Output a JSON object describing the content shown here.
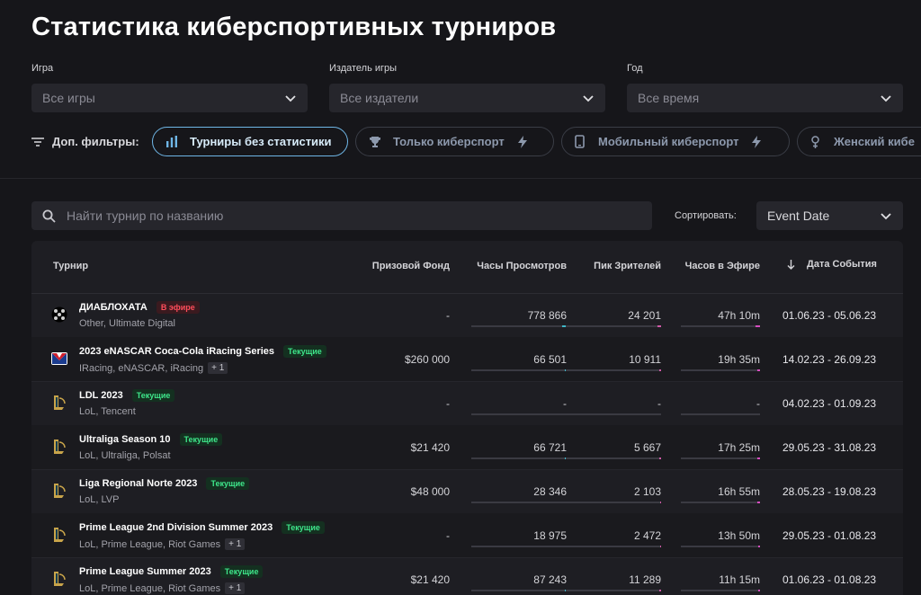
{
  "page_title": "Статистика киберспортивных турниров",
  "filters": {
    "game": {
      "label": "Игра",
      "value": "Все игры"
    },
    "publisher": {
      "label": "Издатель игры",
      "value": "Все издатели"
    },
    "year": {
      "label": "Год",
      "value": "Все время"
    }
  },
  "extra_filters": {
    "label": "Доп. фильтры:",
    "chips": [
      {
        "label": "Турниры без статистики",
        "active": true,
        "icon": "bar-chart-icon"
      },
      {
        "label": "Только киберспорт",
        "active": false,
        "icon": "trophy-icon",
        "badge_icon": "lightning-icon"
      },
      {
        "label": "Мобильный киберспорт",
        "active": false,
        "icon": "phone-icon",
        "badge_icon": "lightning-icon"
      },
      {
        "label": "Женский кибе",
        "active": false,
        "icon": "female-icon"
      }
    ]
  },
  "search": {
    "placeholder": "Найти турнир по названию"
  },
  "sort": {
    "label": "Сортировать:",
    "value": "Event Date"
  },
  "table": {
    "columns": {
      "tournament": "Турнир",
      "prize": "Призовой Фонд",
      "hours_watched": "Часы Просмотров",
      "peak_viewers": "Пик Зрителей",
      "air_hours": "Часов в Эфире",
      "event_date": "Дата События"
    },
    "rows": [
      {
        "name": "ДИАБЛОХАТА",
        "badge": "В эфире",
        "badge_type": "live",
        "sub": "Other, Ultimate Digital",
        "plus": "",
        "prize": "-",
        "hours": "778 866",
        "peak": "24 201",
        "air": "47h 10m",
        "date": "01.06.23 - 05.06.23",
        "logo": "diablo-logo-icon",
        "bars": [
          0.05,
          0.04,
          0.06
        ]
      },
      {
        "name": "2023 eNASCAR Coca-Cola iRacing Series",
        "badge": "Текущие",
        "badge_type": "cur",
        "sub": "IRacing, eNASCAR, iRacing",
        "plus": "+ 1",
        "prize": "$260 000",
        "hours": "66 501",
        "peak": "10 911",
        "air": "19h 35m",
        "date": "14.02.23 - 26.09.23",
        "logo": "iracing-logo-icon",
        "bars": [
          0.02,
          0.02,
          0.03
        ]
      },
      {
        "name": "LDL 2023",
        "badge": "Текущие",
        "badge_type": "cur",
        "sub": "LoL, Tencent",
        "plus": "",
        "prize": "-",
        "hours": "-",
        "peak": "-",
        "air": "-",
        "date": "04.02.23 - 01.09.23",
        "logo": "lol-logo-icon",
        "bars": [
          0,
          0,
          0
        ]
      },
      {
        "name": "Ultraliga Season 10",
        "badge": "Текущие",
        "badge_type": "cur",
        "sub": "LoL, Ultraliga, Polsat",
        "plus": "",
        "prize": "$21 420",
        "hours": "66 721",
        "peak": "5 667",
        "air": "17h 25m",
        "date": "29.05.23 - 31.08.23",
        "logo": "lol-logo-icon",
        "bars": [
          0.02,
          0.02,
          0.03
        ]
      },
      {
        "name": "Liga Regional Norte 2023",
        "badge": "Текущие",
        "badge_type": "cur",
        "sub": "LoL, LVP",
        "plus": "",
        "prize": "$48 000",
        "hours": "28 346",
        "peak": "2 103",
        "air": "16h 55m",
        "date": "28.05.23 - 19.08.23",
        "logo": "lol-logo-icon",
        "bars": [
          0.01,
          0.01,
          0.03
        ]
      },
      {
        "name": "Prime League 2nd Division Summer 2023",
        "badge": "Текущие",
        "badge_type": "cur",
        "sub": "LoL, Prime League, Riot Games",
        "plus": "+ 1",
        "prize": "-",
        "hours": "18 975",
        "peak": "2 472",
        "air": "13h 50m",
        "date": "29.05.23 - 01.08.23",
        "logo": "lol-logo-icon",
        "bars": [
          0.01,
          0.01,
          0.02
        ]
      },
      {
        "name": "Prime League Summer 2023",
        "badge": "Текущие",
        "badge_type": "cur",
        "sub": "LoL, Prime League, Riot Games",
        "plus": "+ 1",
        "prize": "$21 420",
        "hours": "87 243",
        "peak": "11 289",
        "air": "11h 15m",
        "date": "01.06.23 - 01.08.23",
        "logo": "lol-logo-icon",
        "bars": [
          0.02,
          0.02,
          0.02
        ]
      }
    ]
  },
  "colors": {
    "accent": "#6fb6e6",
    "live": "#ff4d5b",
    "current": "#3ee68a",
    "bar_hours": "#3fb8c8",
    "bar_peak": "#d05aa8",
    "bar_air": "#d64ec0"
  }
}
